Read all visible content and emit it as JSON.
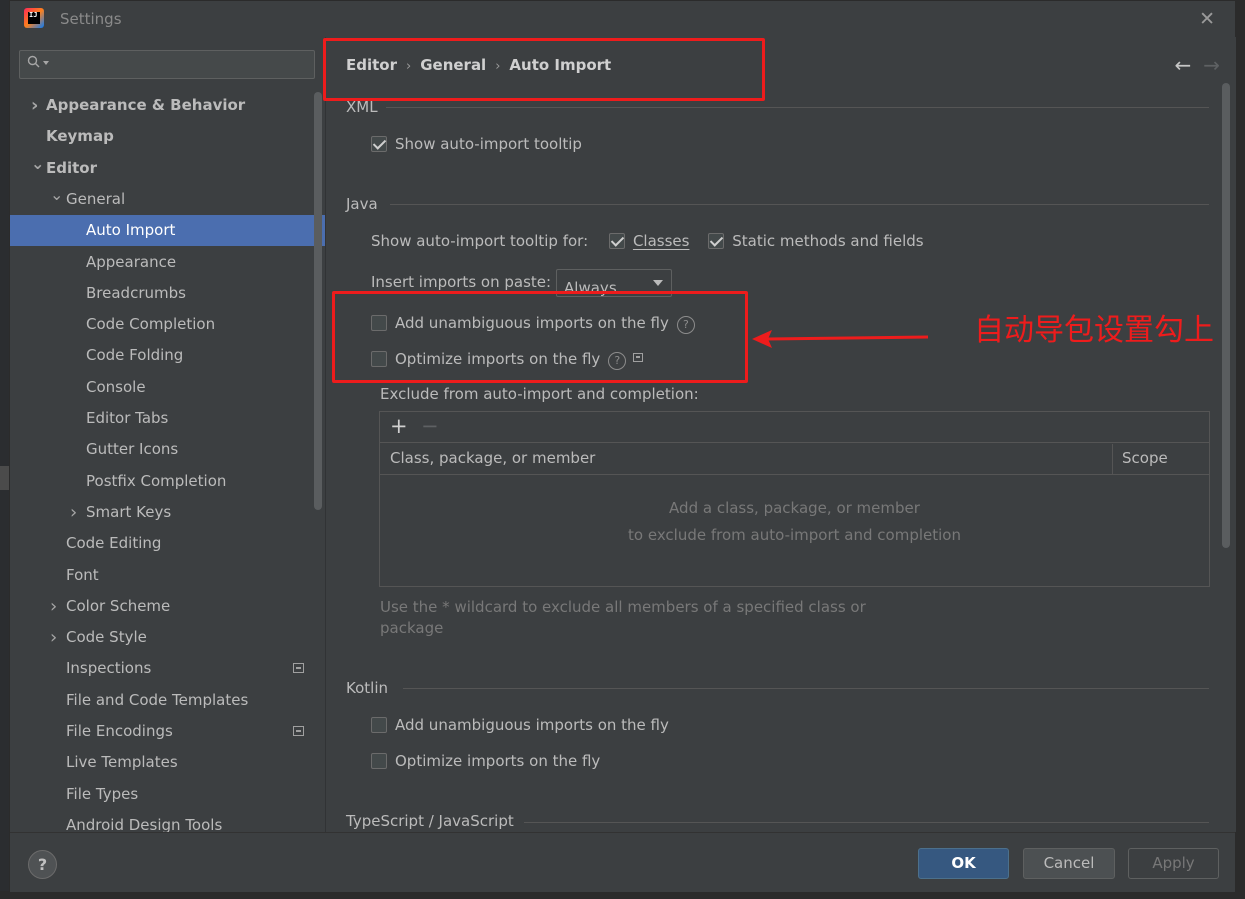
{
  "window": {
    "title": "Settings",
    "app_icon": "intellij-icon"
  },
  "search": {
    "placeholder": ""
  },
  "tree": [
    {
      "label": "Appearance & Behavior",
      "bold": true,
      "chevron": "right",
      "level": 0
    },
    {
      "label": "Keymap",
      "bold": true,
      "chevron": "",
      "level": 0
    },
    {
      "label": "Editor",
      "bold": true,
      "chevron": "down",
      "level": 0
    },
    {
      "label": "General",
      "bold": false,
      "chevron": "down",
      "level": 1
    },
    {
      "label": "Auto Import",
      "bold": false,
      "chevron": "",
      "level": 2,
      "selected": true
    },
    {
      "label": "Appearance",
      "bold": false,
      "chevron": "",
      "level": 2
    },
    {
      "label": "Breadcrumbs",
      "bold": false,
      "chevron": "",
      "level": 2
    },
    {
      "label": "Code Completion",
      "bold": false,
      "chevron": "",
      "level": 2
    },
    {
      "label": "Code Folding",
      "bold": false,
      "chevron": "",
      "level": 2
    },
    {
      "label": "Console",
      "bold": false,
      "chevron": "",
      "level": 2
    },
    {
      "label": "Editor Tabs",
      "bold": false,
      "chevron": "",
      "level": 2
    },
    {
      "label": "Gutter Icons",
      "bold": false,
      "chevron": "",
      "level": 2
    },
    {
      "label": "Postfix Completion",
      "bold": false,
      "chevron": "",
      "level": 2
    },
    {
      "label": "Smart Keys",
      "bold": false,
      "chevron": "right",
      "level": 2
    },
    {
      "label": "Code Editing",
      "bold": false,
      "chevron": "",
      "level": 1
    },
    {
      "label": "Font",
      "bold": false,
      "chevron": "",
      "level": 1
    },
    {
      "label": "Color Scheme",
      "bold": false,
      "chevron": "right",
      "level": 1
    },
    {
      "label": "Code Style",
      "bold": false,
      "chevron": "right",
      "level": 1
    },
    {
      "label": "Inspections",
      "bold": false,
      "chevron": "",
      "level": 1,
      "badge": true
    },
    {
      "label": "File and Code Templates",
      "bold": false,
      "chevron": "",
      "level": 1
    },
    {
      "label": "File Encodings",
      "bold": false,
      "chevron": "",
      "level": 1,
      "badge": true
    },
    {
      "label": "Live Templates",
      "bold": false,
      "chevron": "",
      "level": 1
    },
    {
      "label": "File Types",
      "bold": false,
      "chevron": "",
      "level": 1
    },
    {
      "label": "Android Design Tools",
      "bold": false,
      "chevron": "",
      "level": 1
    }
  ],
  "breadcrumb": {
    "items": [
      "Editor",
      "General",
      "Auto Import"
    ],
    "separator": "›"
  },
  "nav": {
    "back": "←",
    "forward": "→"
  },
  "xml": {
    "title": "XML",
    "show_tooltip": {
      "label": "Show auto-import tooltip",
      "checked": true
    }
  },
  "java": {
    "title": "Java",
    "tooltip_for_label": "Show auto-import tooltip for:",
    "classes": {
      "label": "Classes",
      "checked": true
    },
    "static": {
      "label": "Static methods and fields",
      "checked": true
    },
    "insert_label": "Insert imports on paste:",
    "insert_value": "Always",
    "add_unambiguous": {
      "label": "Add unambiguous imports on the fly",
      "checked": false
    },
    "optimize": {
      "label": "Optimize imports on the fly",
      "checked": false
    },
    "exclude_label": "Exclude from auto-import and completion:",
    "table": {
      "add": "+",
      "remove": "−",
      "columns": [
        "Class, package, or member",
        "Scope"
      ],
      "empty_line1": "Add a class, package, or member",
      "empty_line2": "to exclude from auto-import and completion"
    },
    "note_line1": "Use the * wildcard to exclude all members of a specified class or",
    "note_line2": "package"
  },
  "kotlin": {
    "title": "Kotlin",
    "add_unambiguous": {
      "label": "Add unambiguous imports on the fly",
      "checked": false
    },
    "optimize": {
      "label": "Optimize imports on the fly",
      "checked": false
    }
  },
  "ts": {
    "title": "TypeScript / JavaScript"
  },
  "annotation": {
    "text": "自动导包设置勾上",
    "color": "#ee1c1c"
  },
  "footer": {
    "help": "?",
    "ok": "OK",
    "cancel": "Cancel",
    "apply": "Apply"
  },
  "colors": {
    "selection": "#4b6eaf",
    "ok_button": "#365880",
    "background": "#3c3f41"
  }
}
